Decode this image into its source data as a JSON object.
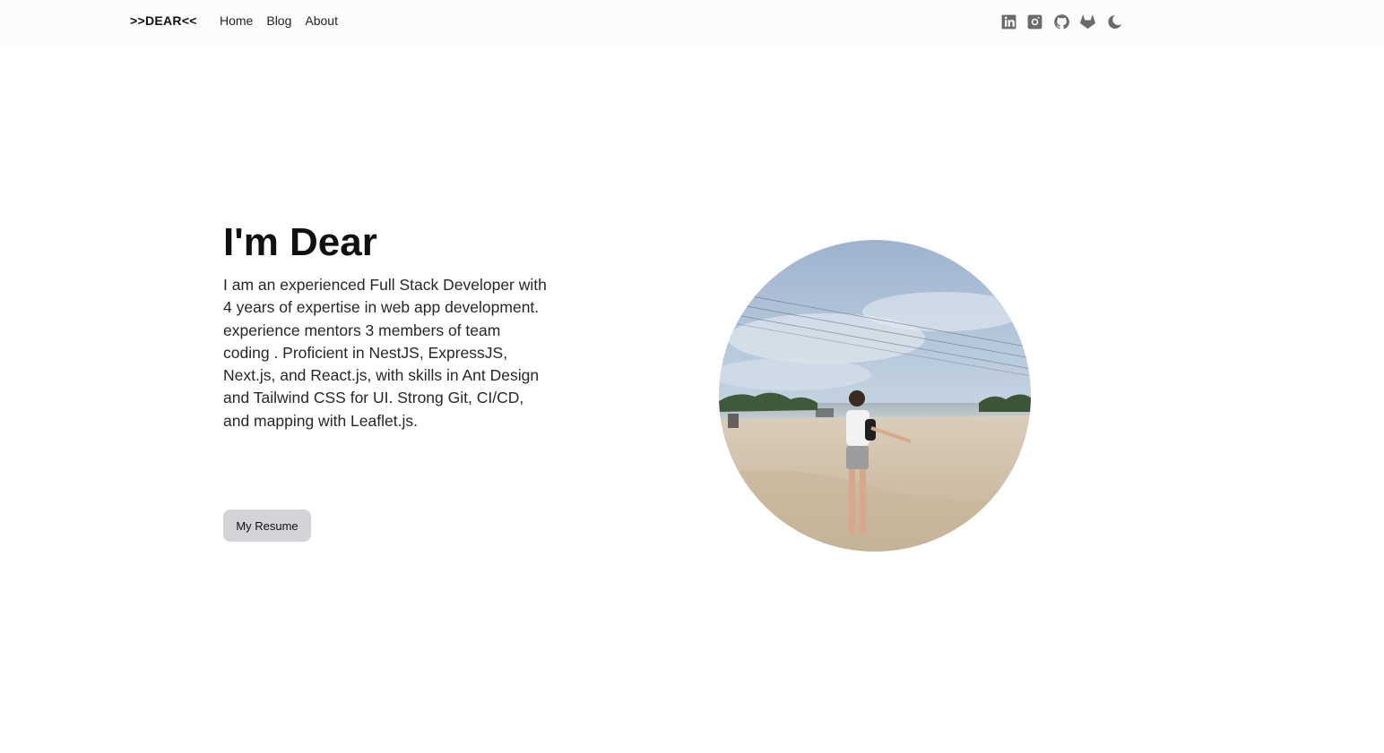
{
  "header": {
    "brand": ">>DEAR<<",
    "nav": [
      {
        "label": "Home"
      },
      {
        "label": "Blog"
      },
      {
        "label": "About"
      }
    ],
    "icons": [
      "linkedin-icon",
      "instagram-icon",
      "github-icon",
      "gitlab-icon",
      "moon-icon"
    ]
  },
  "hero": {
    "title": "I'm Dear",
    "description": "I am an experienced Full Stack Developer with 4 years of expertise in web app development. experience mentors 3 members of team coding . Proficient in NestJS, ExpressJS, Next.js, and React.js, with skills in Ant Design and Tailwind CSS for UI. Strong Git, CI/CD, and mapping with Leaflet.js.",
    "resume_label": "My Resume"
  },
  "colors": {
    "background": "#ffffff",
    "header_bg": "#fcfcfc",
    "button_bg": "#d4d4d8",
    "icon": "#6b6b6b"
  }
}
